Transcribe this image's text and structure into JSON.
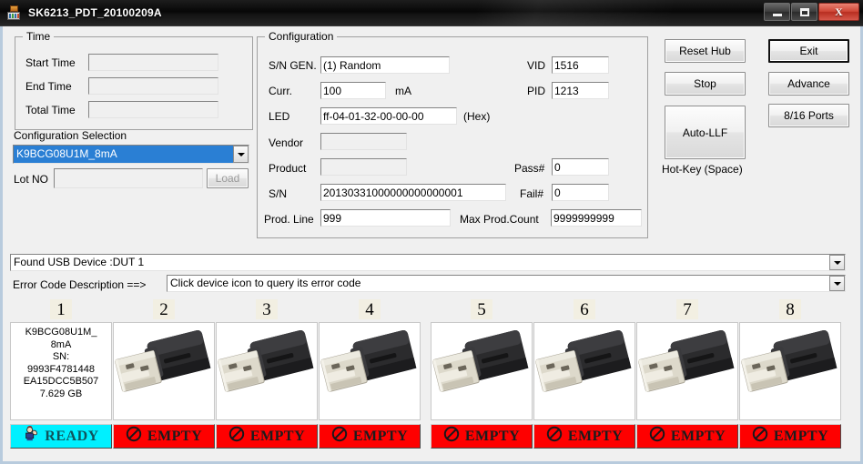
{
  "window": {
    "title": "SK6213_PDT_20100209A",
    "icon": "application-chip-icon",
    "minimize_label": "",
    "maximize_label": "",
    "close_label": "X"
  },
  "time_group": {
    "legend": "Time",
    "rows": [
      {
        "label": "Start Time",
        "value": ""
      },
      {
        "label": "End Time",
        "value": ""
      },
      {
        "label": "Total Time",
        "value": ""
      }
    ]
  },
  "configuration_selection": {
    "label": "Configuration Selection",
    "selected": "K9BCG08U1M_8mA",
    "lot_no_label": "Lot NO",
    "lot_no_value": "",
    "load_label": "Load"
  },
  "configuration": {
    "legend": "Configuration",
    "sn_gen_label": "S/N GEN.",
    "sn_gen_value": "(1) Random",
    "curr_label": "Curr.",
    "curr_value": "100",
    "curr_unit": "mA",
    "led_label": "LED",
    "led_value": "ff-04-01-32-00-00-00",
    "led_unit": "(Hex)",
    "vendor_label": "Vendor",
    "vendor_value": "",
    "product_label": "Product",
    "product_value": "",
    "sn_label": "S/N",
    "sn_value": "20130331000000000000001",
    "prod_line_label": "Prod. Line",
    "prod_line_value": "999",
    "vid_label": "VID",
    "vid_value": "1516",
    "pid_label": "PID",
    "pid_value": "1213",
    "pass_label": "Pass#",
    "pass_value": "0",
    "fail_label": "Fail#",
    "fail_value": "0",
    "max_prod_count_label": "Max Prod.Count",
    "max_prod_count_value": "9999999999"
  },
  "actions": {
    "reset_hub": "Reset Hub",
    "stop": "Stop",
    "auto_llf": "Auto-LLF",
    "hotkey_hint": "Hot-Key (Space)",
    "exit": "Exit",
    "advance": "Advance",
    "ports": "8/16 Ports"
  },
  "status": {
    "device_found": "Found USB Device :DUT 1",
    "error_code_label": "Error Code Description ==>",
    "error_code_value": "Click device icon to query its error code"
  },
  "slots": [
    {
      "number": "1",
      "type": "info",
      "info_lines": [
        "K9BCG08U1M_",
        "8mA",
        "SN:",
        "9993F4781448",
        "EA15DCC5B507",
        "7.629 GB"
      ],
      "status": "READY",
      "status_kind": "ready",
      "status_icon": "ready-hand-icon"
    },
    {
      "number": "2",
      "type": "usb",
      "status": "EMPTY",
      "status_kind": "empty",
      "status_icon": "no-entry-icon"
    },
    {
      "number": "3",
      "type": "usb",
      "status": "EMPTY",
      "status_kind": "empty",
      "status_icon": "no-entry-icon"
    },
    {
      "number": "4",
      "type": "usb",
      "status": "EMPTY",
      "status_kind": "empty",
      "status_icon": "no-entry-icon"
    },
    {
      "number": "5",
      "type": "usb",
      "status": "EMPTY",
      "status_kind": "empty",
      "status_icon": "no-entry-icon"
    },
    {
      "number": "6",
      "type": "usb",
      "status": "EMPTY",
      "status_kind": "empty",
      "status_icon": "no-entry-icon"
    },
    {
      "number": "7",
      "type": "usb",
      "status": "EMPTY",
      "status_kind": "empty",
      "status_icon": "no-entry-icon"
    },
    {
      "number": "8",
      "type": "usb",
      "status": "EMPTY",
      "status_kind": "empty",
      "status_icon": "no-entry-icon"
    }
  ],
  "colors": {
    "empty_bg": "#fe0000",
    "ready_bg": "#00f0ff",
    "selection_blue": "#2a7fd4",
    "slot_number_bg": "#f2efe2"
  }
}
